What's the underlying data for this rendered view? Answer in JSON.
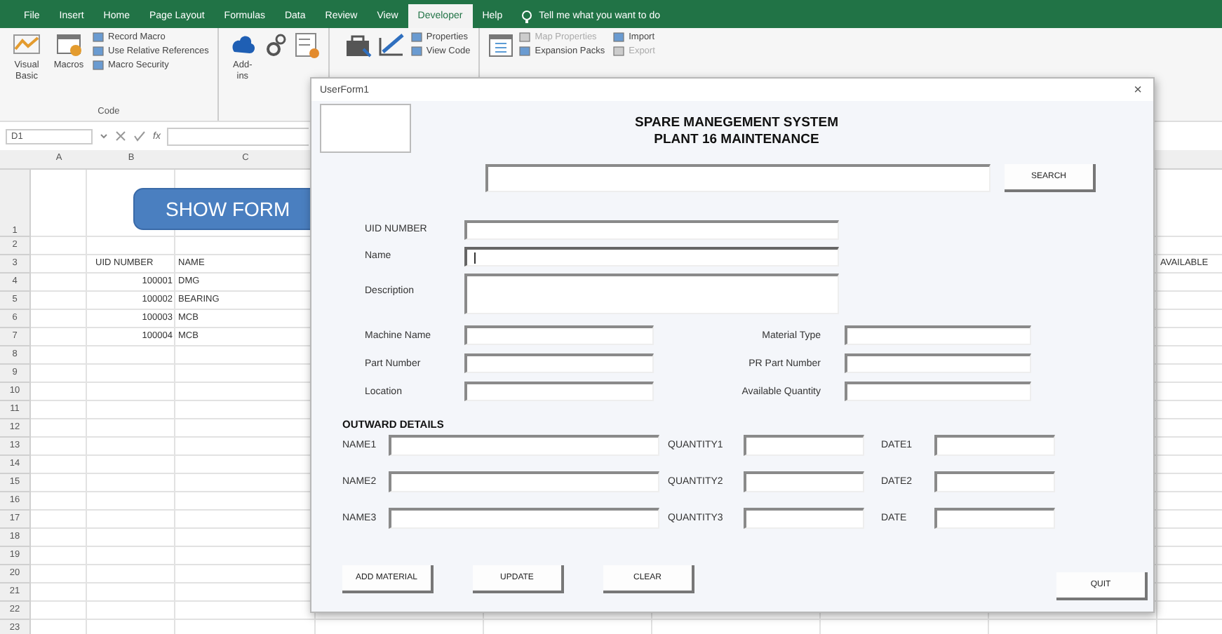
{
  "ribbon": {
    "tabs": [
      {
        "label": "File",
        "selected": false
      },
      {
        "label": "Insert",
        "selected": false
      },
      {
        "label": "Home",
        "selected": false
      },
      {
        "label": "Page Layout",
        "selected": false
      },
      {
        "label": "Formulas",
        "selected": false
      },
      {
        "label": "Data",
        "selected": false
      },
      {
        "label": "Review",
        "selected": false
      },
      {
        "label": "View",
        "selected": false
      },
      {
        "label": "Developer",
        "selected": true
      },
      {
        "label": "Help",
        "selected": false
      }
    ],
    "tell_me": "Tell me what you want to do",
    "code_group": {
      "label": "Code",
      "large": [
        "Visual Basic",
        "Macros"
      ],
      "small": [
        {
          "label": "Record Macro",
          "disabled": false
        },
        {
          "label": "Use Relative References",
          "disabled": false
        },
        {
          "label": "Macro Security",
          "disabled": false
        }
      ]
    },
    "addins_group": {
      "large": [
        "Add-ins"
      ]
    },
    "controls_group": {
      "small": [
        {
          "label": "Properties",
          "disabled": false
        },
        {
          "label": "View Code",
          "disabled": false
        }
      ]
    },
    "xml_group": {
      "small": [
        {
          "label": "Map Properties",
          "disabled": true
        },
        {
          "label": "Import",
          "disabled": false
        },
        {
          "label": "Expansion Packs",
          "disabled": false
        },
        {
          "label": "Export",
          "disabled": true
        }
      ]
    }
  },
  "formula_bar": {
    "name_box": "D1",
    "function_symbol": "fx"
  },
  "sheet": {
    "column_headers": [
      "A",
      "B",
      "C"
    ],
    "show_form_button": "SHOW FORM",
    "rows": [
      {
        "number": "1"
      },
      {
        "number": "2"
      },
      {
        "number": "3",
        "b": "UID NUMBER",
        "c": "NAME",
        "i": "AVAILABLE"
      },
      {
        "number": "4",
        "b": "100001",
        "c": "DMG"
      },
      {
        "number": "5",
        "b": "100002",
        "c": "BEARING"
      },
      {
        "number": "6",
        "b": "100003",
        "c": "MCB"
      },
      {
        "number": "7",
        "b": "100004",
        "c": "MCB"
      },
      {
        "number": "8"
      },
      {
        "number": "9"
      },
      {
        "number": "10"
      },
      {
        "number": "11"
      },
      {
        "number": "12"
      },
      {
        "number": "13"
      },
      {
        "number": "14"
      },
      {
        "number": "15"
      },
      {
        "number": "16"
      },
      {
        "number": "17"
      },
      {
        "number": "18"
      },
      {
        "number": "19"
      },
      {
        "number": "20"
      },
      {
        "number": "21"
      },
      {
        "number": "22"
      },
      {
        "number": "23"
      }
    ]
  },
  "userform": {
    "title": "UserForm1",
    "close": "×",
    "heading": [
      "SPARE MANEGEMENT SYSTEM",
      "PLANT 16 MAINTENANCE"
    ],
    "search_button": "SEARCH",
    "fields": [
      {
        "label": "UID NUMBER",
        "kind": "single",
        "focused": false
      },
      {
        "label": "Name",
        "kind": "single",
        "focused": true
      },
      {
        "label": "Description",
        "kind": "multiline",
        "focused": false
      }
    ],
    "pair_rows": [
      {
        "left": "Machine Name",
        "right": "Material Type"
      },
      {
        "left": "Part Number",
        "right": "PR Part Number"
      },
      {
        "left": "Location",
        "right": "Available Quantity"
      }
    ],
    "outward": {
      "title": "OUTWARD DETAILS",
      "rows": [
        {
          "name": "NAME1",
          "quantity": "QUANTITY1",
          "date": "DATE1"
        },
        {
          "name": "NAME2",
          "quantity": "QUANTITY2",
          "date": "DATE2"
        },
        {
          "name": "NAME3",
          "quantity": "QUANTITY3",
          "date": "DATE"
        }
      ]
    },
    "buttons": [
      "ADD MATERIAL",
      "UPDATE",
      "CLEAR"
    ],
    "quit_button": "QUIT"
  }
}
